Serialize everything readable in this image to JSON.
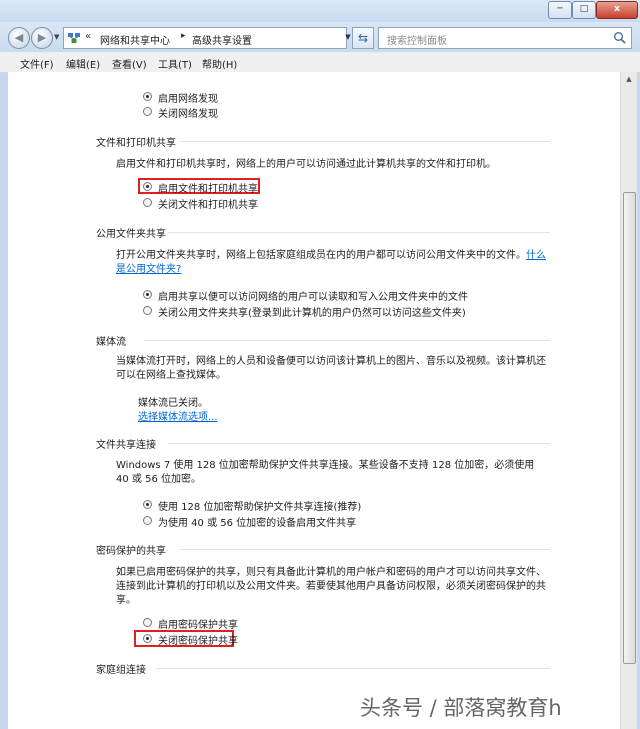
{
  "window": {
    "min_label": "─",
    "max_label": "□",
    "close_label": "x"
  },
  "address": {
    "chevron": "«",
    "crumbs": [
      "网络和共享中心",
      "高级共享设置"
    ],
    "separator": "▸",
    "search_placeholder": "搜索控制面板"
  },
  "menu": [
    "文件(F)",
    "编辑(E)",
    "查看(V)",
    "工具(T)",
    "帮助(H)"
  ],
  "network_discovery": {
    "options": [
      "启用网络发现",
      "关闭网络发现"
    ],
    "selected": 0
  },
  "file_printer": {
    "title": "文件和打印机共享",
    "description": "启用文件和打印机共享时，网络上的用户可以访问通过此计算机共享的文件和打印机。",
    "options": [
      "启用文件和打印机共享",
      "关闭文件和打印机共享"
    ],
    "selected": 0
  },
  "public_folder": {
    "title": "公用文件夹共享",
    "description": "打开公用文件夹共享时，网络上包括家庭组成员在内的用户都可以访问公用文件夹中的文件。",
    "link": "什么是公用文件夹?",
    "options": [
      "启用共享以便可以访问网络的用户可以读取和写入公用文件夹中的文件",
      "关闭公用文件夹共享(登录到此计算机的用户仍然可以访问这些文件夹)"
    ],
    "selected": 0
  },
  "media": {
    "title": "媒体流",
    "description": "当媒体流打开时，网络上的人员和设备便可以访问该计算机上的图片、音乐以及视频。该计算机还可以在网络上查找媒体。",
    "status": "媒体流已关闭。",
    "link": "选择媒体流选项..."
  },
  "file_sharing": {
    "title": "文件共享连接",
    "description": "Windows 7 使用 128 位加密帮助保护文件共享连接。某些设备不支持 128 位加密，必须使用 40 或 56 位加密。",
    "options": [
      "使用 128 位加密帮助保护文件共享连接(推荐)",
      "为使用 40 或 56 位加密的设备启用文件共享"
    ],
    "selected": 0
  },
  "password": {
    "title": "密码保护的共享",
    "description": "如果已启用密码保护的共享，则只有具备此计算机的用户帐户和密码的用户才可以访问共享文件、连接到此计算机的打印机以及公用文件夹。若要使其他用户具备访问权限，必须关闭密码保护的共享。",
    "options": [
      "启用密码保护共享",
      "关闭密码保护共享"
    ],
    "selected": 1
  },
  "homegroup": {
    "title": "家庭组连接"
  },
  "watermark": "头条号 / 部落窝教育h",
  "colors": {
    "highlight": "#e02020",
    "link": "#0066cc"
  }
}
